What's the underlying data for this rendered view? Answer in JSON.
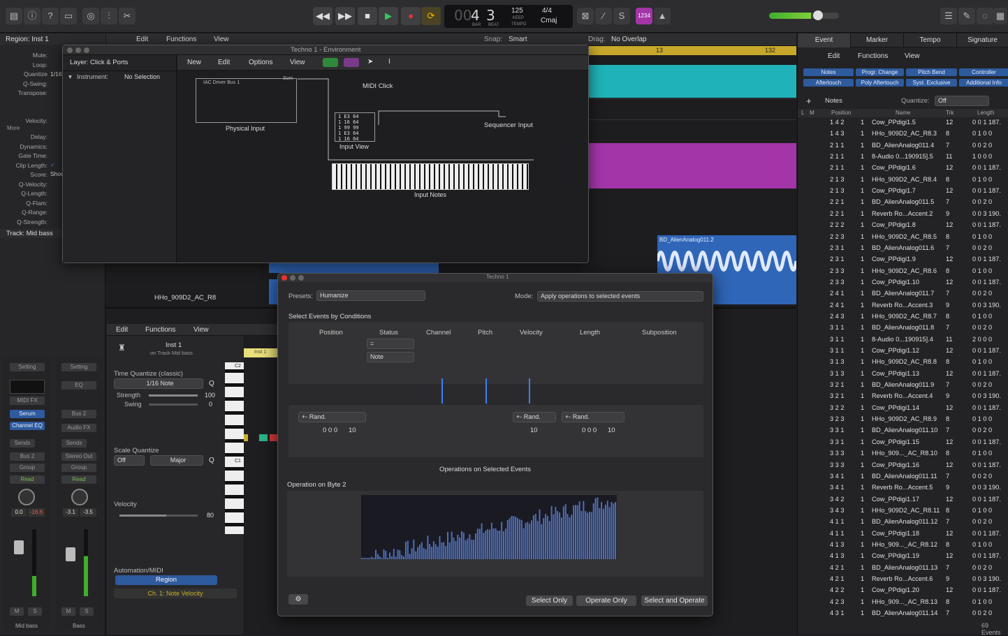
{
  "control_bar": {
    "lcd": {
      "bar": "4",
      "beat": "3",
      "bar_label": "BAR",
      "beat_label": "BEAT",
      "tempo": "125",
      "tempo_sub": "KEEP",
      "tempo_label": "TEMPO",
      "signature": "4/4",
      "key": "Cmaj"
    },
    "count_in_label": "1234"
  },
  "inspector": {
    "region_title": "Region: Inst 1",
    "params": [
      {
        "label": "Mute:",
        "value": ""
      },
      {
        "label": "Loop:",
        "value": ""
      },
      {
        "label": "Quantize",
        "value": "1/16"
      },
      {
        "label": "Q-Swing:",
        "value": ""
      },
      {
        "label": "Transpose:",
        "value": ""
      },
      {
        "label": "Velocity:",
        "value": ""
      }
    ],
    "more_label": "More",
    "more_params": [
      "Delay:",
      "Dynamics:",
      "Gate Time:",
      "Clip Length:",
      "Score:",
      "Q-Velocity:",
      "Q-Length:",
      "Q-Flam:",
      "Q-Range:",
      "Q-Strength:"
    ],
    "score_value": "Show",
    "track_title": "Track: Mid bass",
    "strip1": {
      "setting": "Setting",
      "midi_fx": "MIDI FX",
      "instrument": "Serum",
      "eq": "Channel EQ",
      "sends": "Sends",
      "bus": "Bus 2",
      "group": "Group",
      "read": "Read",
      "vol": "0.0",
      "peak": "-16.6",
      "m": "M",
      "s": "S",
      "name": "Mid bass"
    },
    "strip2": {
      "setting": "Setting",
      "eq": "EQ",
      "output": "Bus 2",
      "audio_fx": "Audio FX",
      "sends": "Sends",
      "stereo": "Stereo Out",
      "group": "Group",
      "read": "Read",
      "vol": "-3.1",
      "peak": "-3.5",
      "m": "M",
      "s": "S",
      "name": "Bass"
    }
  },
  "main_toolbar": {
    "menus": [
      "Edit",
      "Functions",
      "View"
    ],
    "snap_label": "Snap:",
    "snap_value": "Smart",
    "drag_label": "Drag:",
    "drag_value": "No Overlap"
  },
  "ruler": {
    "marks": [
      "13",
      "132"
    ]
  },
  "tracks": {
    "region_label": "BD_AlienAnalog011.2",
    "track_name": "HHo_909D2_AC_R8",
    "ruler2": "73"
  },
  "environment": {
    "title": "Techno 1 - Environment",
    "layer_label": "Layer: Click & Ports",
    "instrument_label": "Instrument:",
    "instrument_value": "No Selection",
    "menus": [
      "New",
      "Edit",
      "Options",
      "View"
    ],
    "objects": {
      "iac": "IAC Driver Bus 1",
      "sum": "Sum",
      "physical": "Physical Input",
      "midi_click": "MIDI Click",
      "input_view": "Input View",
      "sequencer": "Sequencer Input",
      "input_notes": "Input Notes"
    },
    "monitor_rows": [
      "1 E3  64",
      "1 16  64",
      "1 99  99",
      "1 E3  64",
      "1 16  64"
    ]
  },
  "piano_roll": {
    "menus": [
      "Edit",
      "Functions",
      "View"
    ],
    "inst_name": "Inst 1",
    "inst_sub": "on Track Mid bass",
    "tq_title": "Time Quantize (classic)",
    "tq_value": "1/16 Note",
    "q": "Q",
    "strength_label": "Strength",
    "strength_value": "100",
    "swing_label": "Swing",
    "swing_value": "0",
    "sq_title": "Scale Quantize",
    "sq_off": "Off",
    "sq_scale": "Major",
    "velocity_label": "Velocity",
    "velocity_value": "80",
    "automation_title": "Automation/MIDI",
    "region_btn": "Region",
    "param": "Ch. 1: Note Velocity",
    "key_c2": "C2",
    "key_c1": "C1",
    "region_tag": "Inst 1",
    "strength_level": 1.0,
    "swing_level": 0.0,
    "velocity_level": 0.6
  },
  "transform": {
    "title": "Techno 1",
    "presets_label": "Presets:",
    "presets_value": "Humanize",
    "mode_label": "Mode:",
    "mode_value": "Apply operations to selected events",
    "select_title": "Select Events by Conditions",
    "columns": [
      "Position",
      "Status",
      "Channel",
      "Pitch",
      "Velocity",
      "Length",
      "Subposition"
    ],
    "status_cond": "=",
    "status_value": "Note",
    "op1": "+- Rand.",
    "op1_val": "0 0 0",
    "op1_val2": "10",
    "op2": "+- Rand.",
    "op2_val": "10",
    "op3": "+- Rand.",
    "op3_val": "0 0 0",
    "op3_val2": "10",
    "ops_title": "Operations on Selected Events",
    "byte_title": "Operation on Byte 2",
    "buttons": [
      "Select Only",
      "Operate Only",
      "Select and Operate"
    ]
  },
  "event_list": {
    "tabs": [
      "Event",
      "Marker",
      "Tempo",
      "Signature"
    ],
    "menus": [
      "Edit",
      "Functions",
      "View"
    ],
    "filters": [
      [
        "Notes",
        "Progr. Change",
        "Pitch Bend",
        "Controller"
      ],
      [
        "Aftertouch",
        "Poly Aftertouch",
        "Syst. Exclusive",
        "Additional Info"
      ]
    ],
    "notes_label": "Notes",
    "quantize_label": "Quantize:",
    "quantize_value": "Off",
    "headers": {
      "l": "L",
      "m": "M",
      "position": "Position",
      "name": "Name",
      "trk": "Trk",
      "length": "Length"
    },
    "rows": [
      [
        "1 4 2",
        "1",
        "Cow_PPdigi1.5",
        "12",
        "0 0 1 187."
      ],
      [
        "1 4 3",
        "1",
        "HHo_909D2_AC_R8.3",
        "8",
        "0 1 0     0"
      ],
      [
        "2 1 1",
        "1",
        "BD_AlienAnalog011.4",
        "7",
        "0 0 2     0"
      ],
      [
        "2 1 1",
        "1",
        "8-Audio 0...190915].5",
        "11",
        "1 0 0     0"
      ],
      [
        "2 1 1",
        "1",
        "Cow_PPdigi1.6",
        "12",
        "0 0 1 187."
      ],
      [
        "2 1 3",
        "1",
        "HHo_909D2_AC_R8.4",
        "8",
        "0 1 0     0"
      ],
      [
        "2 1 3",
        "1",
        "Cow_PPdigi1.7",
        "12",
        "0 0 1 187."
      ],
      [
        "2 2 1",
        "1",
        "BD_AlienAnalog011.5",
        "7",
        "0 0 2     0"
      ],
      [
        "2 2 1",
        "1",
        "Reverb Ro...Accent.2",
        "9",
        "0 0 3 190."
      ],
      [
        "2 2 2",
        "1",
        "Cow_PPdigi1.8",
        "12",
        "0 0 1 187."
      ],
      [
        "2 2 3",
        "1",
        "HHo_909D2_AC_R8.5",
        "8",
        "0 1 0     0"
      ],
      [
        "2 3 1",
        "1",
        "BD_AlienAnalog011.6",
        "7",
        "0 0 2     0"
      ],
      [
        "2 3 1",
        "1",
        "Cow_PPdigi1.9",
        "12",
        "0 0 1 187."
      ],
      [
        "2 3 3",
        "1",
        "HHo_909D2_AC_R8.6",
        "8",
        "0 1 0     0"
      ],
      [
        "2 3 3",
        "1",
        "Cow_PPdigi1.10",
        "12",
        "0 0 1 187."
      ],
      [
        "2 4 1",
        "1",
        "BD_AlienAnalog011.7",
        "7",
        "0 0 2     0"
      ],
      [
        "2 4 1",
        "1",
        "Reverb Ro...Accent.3",
        "9",
        "0 0 3 190."
      ],
      [
        "2 4 3",
        "1",
        "HHo_909D2_AC_R8.7",
        "8",
        "0 1 0     0"
      ],
      [
        "3 1 1",
        "1",
        "BD_AlienAnalog011.8",
        "7",
        "0 0 2     0"
      ],
      [
        "3 1 1",
        "1",
        "8-Audio 0...190915].4",
        "11",
        "2 0 0     0"
      ],
      [
        "3 1 1",
        "1",
        "Cow_PPdigi1.12",
        "12",
        "0 0 1 187."
      ],
      [
        "3 1 3",
        "1",
        "HHo_909D2_AC_R8.8",
        "8",
        "0 1 0     0"
      ],
      [
        "3 1 3",
        "1",
        "Cow_PPdigi1.13",
        "12",
        "0 0 1 187."
      ],
      [
        "3 2 1",
        "1",
        "BD_AlienAnalog011.9",
        "7",
        "0 0 2     0"
      ],
      [
        "3 2 1",
        "1",
        "Reverb Ro...Accent.4",
        "9",
        "0 0 3 190."
      ],
      [
        "3 2 2",
        "1",
        "Cow_PPdigi1.14",
        "12",
        "0 0 1 187."
      ],
      [
        "3 2 3",
        "1",
        "HHo_909D2_AC_R8.9",
        "8",
        "0 1 0     0"
      ],
      [
        "3 3 1",
        "1",
        "BD_AlienAnalog011.10",
        "7",
        "0 0 2     0"
      ],
      [
        "3 3 1",
        "1",
        "Cow_PPdigi1.15",
        "12",
        "0 0 1 187."
      ],
      [
        "3 3 3",
        "1",
        "HHo_909..._AC_R8.10",
        "8",
        "0 1 0     0"
      ],
      [
        "3 3 3",
        "1",
        "Cow_PPdigi1.16",
        "12",
        "0 0 1 187."
      ],
      [
        "3 4 1",
        "1",
        "BD_AlienAnalog011.11",
        "7",
        "0 0 2     0"
      ],
      [
        "3 4 1",
        "1",
        "Reverb Ro...Accent.5",
        "9",
        "0 0 3 190."
      ],
      [
        "3 4 2",
        "1",
        "Cow_PPdigi1.17",
        "12",
        "0 0 1 187."
      ],
      [
        "3 4 3",
        "1",
        "HHo_909D2_AC_R8.11",
        "8",
        "0 1 0     0"
      ],
      [
        "4 1 1",
        "1",
        "BD_AlienAnalog011.12",
        "7",
        "0 0 2     0"
      ],
      [
        "4 1 1",
        "1",
        "Cow_PPdigi1.18",
        "12",
        "0 0 1 187."
      ],
      [
        "4 1 3",
        "1",
        "HHo_909..._AC_R8.12",
        "8",
        "0 1 0     0"
      ],
      [
        "4 1 3",
        "1",
        "Cow_PPdigi1.19",
        "12",
        "0 0 1 187."
      ],
      [
        "4 2 1",
        "1",
        "BD_AlienAnalog011.13",
        "7",
        "0 0 2     0"
      ],
      [
        "4 2 1",
        "1",
        "Reverb Ro...Accent.6",
        "9",
        "0 0 3 190."
      ],
      [
        "4 2 2",
        "1",
        "Cow_PPdigi1.20",
        "12",
        "0 0 1 187."
      ],
      [
        "4 2 3",
        "1",
        "HHo_909..._AC_R8.13",
        "8",
        "0 1 0     0"
      ],
      [
        "4 3 1",
        "1",
        "BD_AlienAnalog011.14",
        "7",
        "0 0 2     0"
      ]
    ],
    "footer": "69 Events"
  },
  "colors": {
    "accent": "#3b82f6",
    "play": "#34c759",
    "record": "#e5322d",
    "cycle": "#f5b800",
    "teal": "#1fb2b8",
    "magenta": "#a335a8",
    "audio_blue": "#2f66b8"
  }
}
